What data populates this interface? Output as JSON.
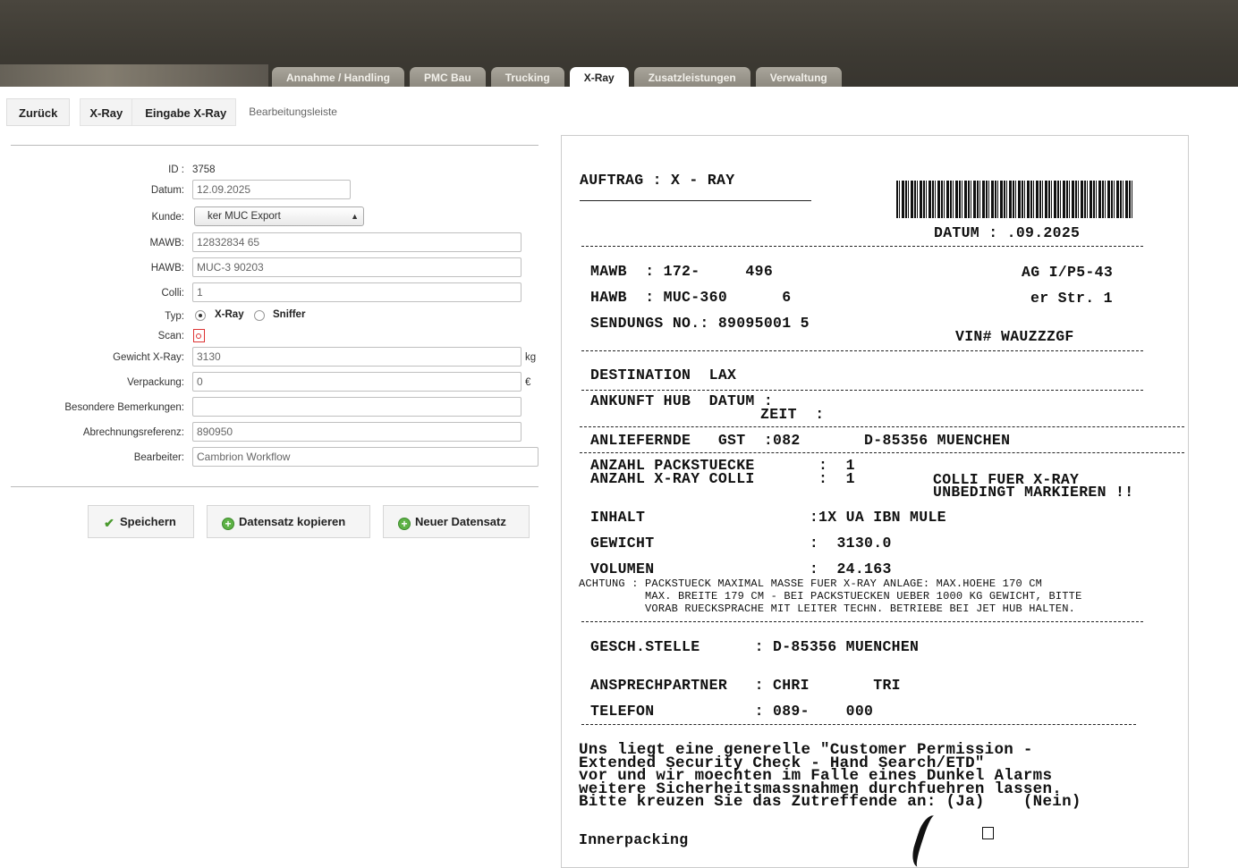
{
  "nav": {
    "tabs": [
      "Annahme / Handling",
      "PMC Bau",
      "Trucking",
      "X-Ray",
      "Zusatzleistungen",
      "Verwaltung"
    ],
    "active_tab": "X-Ray"
  },
  "breadcrumb": {
    "back": "Zurück",
    "items": [
      "X-Ray",
      "Eingabe X-Ray",
      "Bearbeitungsleiste"
    ]
  },
  "form": {
    "id_label": "ID :",
    "id_value": "3758",
    "datum_label": "Datum:",
    "datum_value": "12.09.2025",
    "kunde_label": "Kunde:",
    "kunde_value": "ker MUC Export",
    "mawb_label": "MAWB:",
    "mawb_value": "12832834 65",
    "hawb_label": "HAWB:",
    "hawb_value": "MUC-3 90203",
    "colli_label": "Colli:",
    "colli_value": "1",
    "typ_label": "Typ:",
    "typ_options": [
      "X-Ray",
      "Sniffer"
    ],
    "typ_selected": "X-Ray",
    "scan_label": "Scan:",
    "gewicht_label": "Gewicht X-Ray:",
    "gewicht_value": "3130",
    "gewicht_unit": "kg",
    "verpackung_label": "Verpackung:",
    "verpackung_value": "0",
    "verpackung_unit": "€",
    "bemerkungen_label": "Besondere Bemerkungen:",
    "bemerkungen_value": "",
    "abrechnung_label": "Abrechnungsreferenz:",
    "abrechnung_value": "890950",
    "bearbeiter_label": "Bearbeiter:",
    "bearbeiter_value": "Cambrion Workflow"
  },
  "actions": {
    "save": "Speichern",
    "copy": "Datensatz kopieren",
    "new": "Neuer Datensatz"
  },
  "document": {
    "title": "AUFTRAG : X - RAY",
    "datum": "DATUM : .09.2025",
    "mawb": "MAWB  : 172-     496",
    "hawb": "HAWB  : MUC-360      6",
    "sendung": "SENDUNGS NO.: 89095001 5",
    "company": "AG I/P5-43",
    "street": "er Str. 1",
    "vin": "VIN# WAUZZZGF",
    "destination": "DESTINATION  LAX",
    "ankunft": "ANKUNFT HUB  DATUM :",
    "zeit": "ZEIT  :",
    "anliefernde": "ANLIEFERNDE   GST  :082       D-85356 MUENCHEN",
    "anzahl_pack": "ANZAHL PACKSTUECKE       :  1",
    "anzahl_xray": "ANZAHL X-RAY COLLI       :  1",
    "colli_note1": "COLLI FUER X-RAY",
    "colli_note2": "UNBEDINGT MARKIEREN !!",
    "inhalt": "INHALT                  :1X UA IBN MULE",
    "gewicht": "GEWICHT                 :  3130.0",
    "volumen": "VOLUMEN                 :  24.163",
    "achtung1": "ACHTUNG : PACKSTUECK MAXIMAL MASSE FUER X-RAY ANLAGE: MAX.HOEHE 170 CM",
    "achtung2": "          MAX. BREITE 179 CM - BEI PACKSTUECKEN UEBER 1000 KG GEWICHT, BITTE",
    "achtung3": "          VORAB RUECKSPRACHE MIT LEITER TECHN. BETRIEBE BEI JET HUB HALTEN.",
    "gesch": "GESCH.STELLE      : D-85356 MUENCHEN",
    "ansprech": "ANSPRECHPARTNER   : CHRI       TRI",
    "telefon": "TELEFON           : 089-    000",
    "perm1": "Uns liegt eine generelle \"Customer Permission -",
    "perm2": "Extended Security Check - Hand Search/ETD\"",
    "perm3": "vor und wir moechten im Falle eines Dunkel Alarms",
    "perm4": "weitere Sicherheitsmassnahmen durchfuehren lassen.",
    "perm5": "Bitte kreuzen Sie das Zutreffende an: (Ja)    (Nein)",
    "inner": "Innerpacking"
  }
}
